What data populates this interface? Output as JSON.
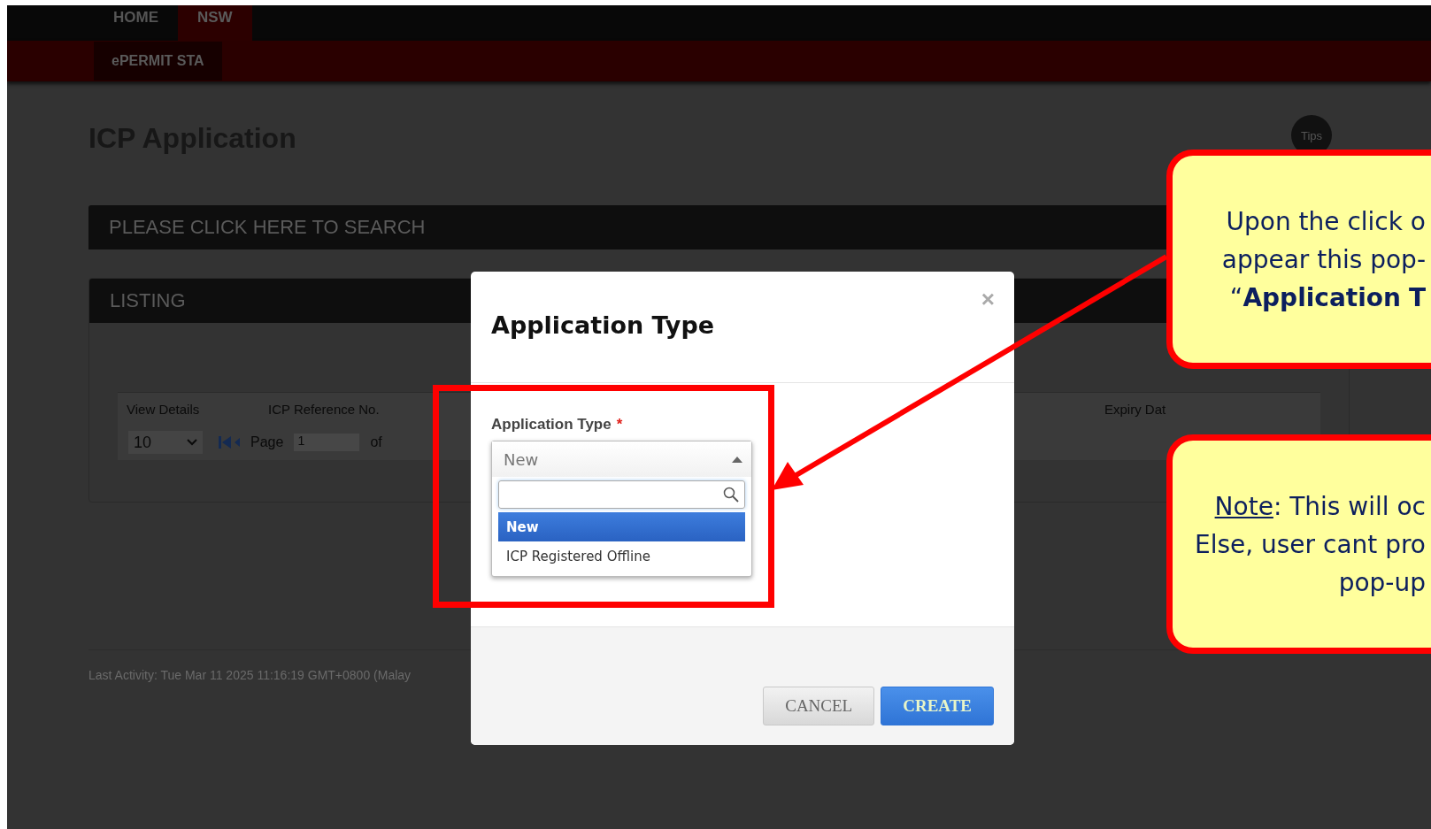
{
  "nav": {
    "tabs": [
      {
        "label": "HOME",
        "selected": false
      },
      {
        "label": "NSW",
        "selected": true
      }
    ],
    "subtabs": [
      {
        "label": "ePERMIT STA",
        "selected": true
      }
    ]
  },
  "page": {
    "title": "ICP Application",
    "tips": "Tips",
    "search_bar": "PLEASE CLICK HERE TO SEARCH",
    "listing": {
      "title": "LISTING",
      "columns": [
        "View Details",
        "ICP Reference No.",
        "Expiry Dat"
      ],
      "pager": {
        "page_size": "10",
        "page_label": "Page",
        "page": "1",
        "of": "of"
      }
    },
    "last_activity": "Last Activity: Tue Mar 11 2025 11:16:19 GMT+0800 (Malay"
  },
  "dialog": {
    "title": "Application Type",
    "close": "×",
    "field": {
      "label": "Application Type",
      "required": true,
      "required_mark": "*",
      "value": "New",
      "expanded": true,
      "options": [
        {
          "label": "New",
          "selected": true
        },
        {
          "label": "ICP Registered Offline",
          "selected": false
        }
      ]
    },
    "buttons": [
      {
        "label": "CANCEL",
        "kind": "secondary"
      },
      {
        "label": "CREATE",
        "kind": "primary"
      }
    ]
  },
  "callouts": [
    {
      "lines": [
        {
          "text": "Upon the click o"
        },
        {
          "text": "appear this pop-"
        },
        {
          "text": "“**Application** **T**"
        }
      ]
    },
    {
      "lines": [
        {
          "label": "Note",
          "text": ": This will oc"
        },
        {
          "text": "Else, user cant pro"
        },
        {
          "text": "pop-up"
        }
      ]
    }
  ]
}
